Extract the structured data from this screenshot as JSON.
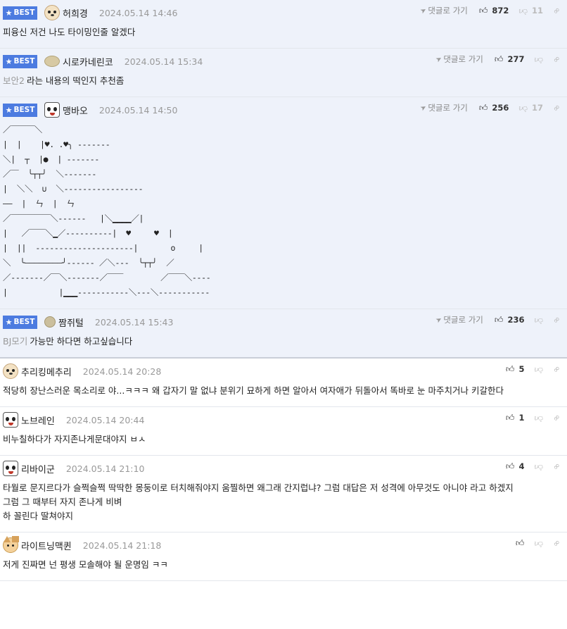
{
  "labels": {
    "best": "BEST",
    "reply": "댓글로 가기"
  },
  "colors": {
    "best_badge": "#4c7be0",
    "best_background": "#eef2fa"
  },
  "comments": [
    {
      "nick": "허희경",
      "date": "2024.05.14 14:46",
      "up": "872",
      "down": "11",
      "text": "피융신 저건 나도 타이밍인줄 알겠다"
    },
    {
      "nick": "시로카네린코",
      "date": "2024.05.14 15:34",
      "up": "277",
      "down": "",
      "prefix": "보안2",
      "text": "라는 내용의 떡인지 추천좀"
    },
    {
      "nick": "맹바오",
      "date": "2024.05.14 14:50",
      "up": "256",
      "down": "17",
      "ascii": "／￣￣￣＼\n|  |    |♥. .♥╮ -------\n＼|  ┬  |●  | -------\n／￣  ╰┬┬╯  ＼-------\n|  ＼＼  ∪  ＼-----------------\n——  |  ㄣ  |  ㄣ\n／￣￣￣￣￣＼------   |＼▁▁▁▁／|\n|   ／￣￣＼▁／----------|  ♥     ♥  |\n|  ||  ---------------------|       o     |\n＼  ╰————————╯------ ／＼---  ╰┬┬╯  ／\n／-------／￣＼-------／￣￣        ／￣￣＼----\n|           |▁▁▁-----------＼---＼-----------"
    },
    {
      "nick": "짬쥐털",
      "date": "2024.05.14 15:43",
      "up": "236",
      "down": "",
      "prefix": "BJ모기",
      "text": "가능만 하다면 하고싶습니다"
    },
    {
      "nick": "추리킹메추리",
      "date": "2024.05.14 20:28",
      "up": "5",
      "down": "",
      "text": "적당히 장난스러운 목소리로 야...ㅋㅋㅋ 왜 갑자기 말 없냐 분위기 묘하게 하면 알아서 여자애가 뒤돌아서 똑바로 눈 마주치거나 키갈한다"
    },
    {
      "nick": "노브레인",
      "date": "2024.05.14 20:44",
      "up": "1",
      "down": "",
      "text": "비누칠하다가 자지존나게문대야지 ㅂㅅ"
    },
    {
      "nick": "리바이군",
      "date": "2024.05.14 21:10",
      "up": "4",
      "down": "",
      "lines": [
        "타월로 문지르다가 슬쩍슬쩍 딱딱한 몽둥이로 터치해줘야지 움찔하면 왜그래 간지럽냐? 그럼 대답은 저 성격에 아무것도 아니야 라고 하겠지",
        "그럼 그 때부터 자지 존나게 비벼",
        "하 꼴린다 딸쳐야지"
      ]
    },
    {
      "nick": "라이트닝맥퀸",
      "date": "2024.05.14 21:18",
      "up": "",
      "down": "",
      "text": "저게 진짜면 넌 평생 모솔해야 될 운명임 ㅋㅋ"
    }
  ]
}
